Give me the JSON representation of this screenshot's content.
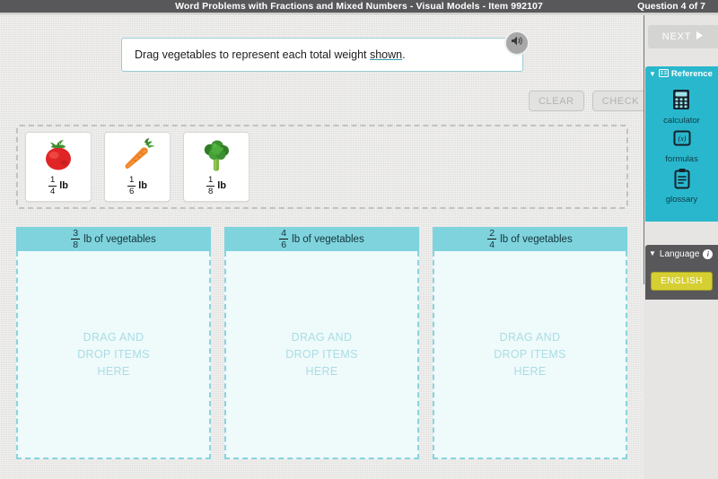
{
  "header": {
    "title": "Word Problems with Fractions and Mixed Numbers - Visual Models - Item 992107",
    "counter": "Question 4 of 7",
    "bg_color": "#58585a"
  },
  "instruction": {
    "text_before": "Drag vegetables to represent each total weight ",
    "link_text": "shown",
    "text_after": ".",
    "audio_icon": "speaker-icon"
  },
  "actions": {
    "clear_label": "CLEAR",
    "check_label": "CHECK"
  },
  "tray": {
    "items": [
      {
        "icon": "tomato-icon",
        "name": "tomato",
        "numerator": "1",
        "denominator": "4",
        "unit": "lb"
      },
      {
        "icon": "carrot-icon",
        "name": "carrot",
        "numerator": "1",
        "denominator": "6",
        "unit": "lb"
      },
      {
        "icon": "broccoli-icon",
        "name": "broccoli",
        "numerator": "1",
        "denominator": "8",
        "unit": "lb"
      }
    ]
  },
  "drop_zones": {
    "hint": "DRAG AND\nDROP ITEMS\nHERE",
    "header_suffix": "lb of vegetables",
    "accent_color": "#7fd3dd",
    "body_color": "#effafb",
    "items": [
      {
        "numerator": "3",
        "denominator": "8"
      },
      {
        "numerator": "4",
        "denominator": "6"
      },
      {
        "numerator": "2",
        "denominator": "4"
      }
    ]
  },
  "sidebar": {
    "next_label": "NEXT",
    "next_icon": "play-triangle-icon",
    "reference": {
      "title": "Reference",
      "title_icon": "reference-book-icon",
      "collapse_icon": "caret-down-icon",
      "color": "#29b7cd",
      "tools": [
        {
          "icon": "calculator-icon",
          "label": "calculator"
        },
        {
          "icon": "formulas-icon",
          "label": "formulas"
        },
        {
          "icon": "glossary-clipboard-icon",
          "label": "glossary"
        }
      ]
    },
    "language": {
      "title": "Language",
      "info_icon": "info-icon",
      "collapse_icon": "caret-down-icon",
      "selected": "ENGLISH",
      "button_color": "#d6cf33"
    }
  }
}
